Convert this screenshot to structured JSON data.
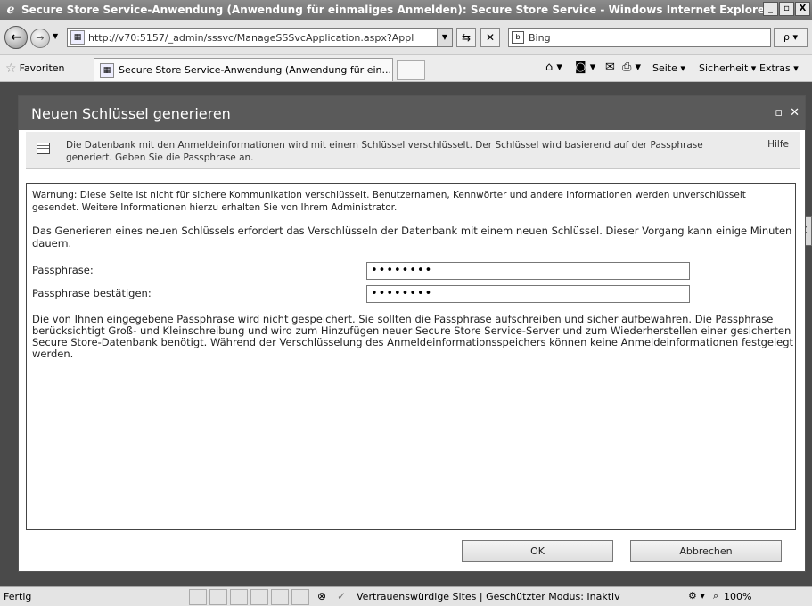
{
  "window": {
    "title": "Secure Store Service-Anwendung (Anwendung für einmaliges Anmelden): Secure Store Service - Windows Internet Explorer",
    "controls": [
      "_",
      "▫",
      "X"
    ]
  },
  "address": {
    "url": "http://v70:5157/_admin/sssvc/ManageSSSvcApplication.aspx?Appl",
    "search_placeholder": "Bing",
    "search_go": "ρ ▾"
  },
  "favorites": {
    "favorites_label": "Favoriten",
    "tab_title": "Secure Store Service-Anwendung (Anwendung für ein...",
    "commands": {
      "page": "Seite ▾",
      "security": "Sicherheit ▾",
      "extras": "Extras ▾",
      "help": "❷ ▾"
    }
  },
  "dialog": {
    "title": "Neuen Schlüssel generieren",
    "info_text": "Die Datenbank mit den Anmeldeinformationen wird mit einem Schlüssel verschlüsselt. Der Schlüssel wird basierend auf der Passphrase generiert. Geben Sie die Passphrase an.",
    "help_link": "Hilfe",
    "warning": "Warnung: Diese Seite ist nicht für sichere Kommunikation verschlüsselt. Benutzernamen, Kennwörter und andere Informationen werden unverschlüsselt gesendet. Weitere Informationen hierzu erhalten Sie von Ihrem Administrator.",
    "description": "Das Generieren eines neuen Schlüssels erfordert das Verschlüsseln der Datenbank mit einem neuen Schlüssel. Dieser Vorgang kann einige Minuten dauern.",
    "passphrase_label": "Passphrase:",
    "passphrase_value": "••••••••",
    "confirm_label": "Passphrase bestätigen:",
    "confirm_value": "••••••••",
    "note": "Die von Ihnen eingegebene Passphrase wird nicht gespeichert. Sie sollten die Passphrase aufschreiben und sicher aufbewahren. Die Passphrase berücksichtigt Groß- und Kleinschreibung und wird zum Hinzufügen neuer Secure Store Service-Server und zum Wiederherstellen einer gesicherten Secure Store-Datenbank benötigt. Während der Verschlüsselung des Anmeldeinformationsspeichers können keine Anmeldeinformationen festgelegt werden.",
    "ok_label": "OK",
    "cancel_label": "Abbrechen"
  },
  "status": {
    "text": "Fertig",
    "zone": "Vertrauenswürdige Sites | Geschützter Modus: Inaktiv",
    "zoom": "100%"
  }
}
